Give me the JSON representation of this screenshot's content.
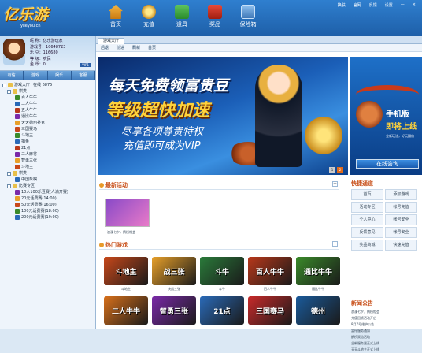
{
  "app": {
    "logo_text": "亿乐游",
    "logo_site": "yileyou.cn"
  },
  "top_links": [
    "换肤",
    "官网",
    "反馈",
    "设置",
    "—",
    "×"
  ],
  "nav": [
    {
      "label": "首页",
      "icon": "home-icon"
    },
    {
      "label": "充值",
      "icon": "coin-bag-icon"
    },
    {
      "label": "道具",
      "icon": "item-icon"
    },
    {
      "label": "奖品",
      "icon": "gift-icon"
    },
    {
      "label": "保险箱",
      "icon": "safe-icon"
    }
  ],
  "profile": {
    "lines": [
      "昵 称：",
      "游戏号：",
      "乐 豆：",
      "等 级：",
      "金 币："
    ],
    "values": [
      "亿乐游玩家",
      "10648723",
      "116680",
      "农民",
      "0"
    ],
    "vip": "VIP1"
  },
  "left_tabs": [
    "有信",
    "游戏",
    "娱乐",
    "客服"
  ],
  "tree": [
    {
      "level": 0,
      "label": "游戏大厅",
      "extra": "在线 6875",
      "toggle": ""
    },
    {
      "level": 1,
      "label": "棋类",
      "toggle": "-"
    },
    {
      "level": 2,
      "label": "百人牛牛"
    },
    {
      "level": 2,
      "label": "二人牛牛"
    },
    {
      "level": 2,
      "label": "五人牛牛"
    },
    {
      "level": 2,
      "label": "通比牛牛"
    },
    {
      "level": 2,
      "label": "天天德州扑克"
    },
    {
      "level": 2,
      "label": "三国赛马"
    },
    {
      "level": 2,
      "label": "斗地主"
    },
    {
      "level": 2,
      "label": "捕鱼"
    },
    {
      "level": 2,
      "label": "21点"
    },
    {
      "level": 2,
      "label": "二人麻将"
    },
    {
      "level": 2,
      "label": "智勇三张"
    },
    {
      "level": 2,
      "label": "斗地主"
    },
    {
      "level": 1,
      "label": "棋类",
      "toggle": "-"
    },
    {
      "level": 2,
      "label": "中国象棋"
    },
    {
      "level": 1,
      "label": "比赛专区",
      "toggle": "-"
    },
    {
      "level": 2,
      "label": "10人100乐豆赛(人满开赛)"
    },
    {
      "level": 2,
      "label": "20元话费赛(14:00)"
    },
    {
      "level": 2,
      "label": "50元话费赛(16:00)"
    },
    {
      "level": 2,
      "label": "100元话费赛(18:00)"
    },
    {
      "level": 2,
      "label": "200元话费赛(19:00)"
    }
  ],
  "main": {
    "page_tab": "游戏大厅",
    "toolbar": [
      "后退",
      "前进",
      "刷新",
      "首页"
    ],
    "banner": {
      "line1": "每天免费领富贵豆",
      "line2": "等级超快加速",
      "line3": "尽享各项尊贵特权",
      "line4": "充值即可成为VIP",
      "pages": [
        "1",
        "2"
      ]
    },
    "side_ad": {
      "title": "手机版",
      "subtitle": "即将上线",
      "sub2": "全新玩法，好玩翻倍",
      "button": "在线咨询"
    },
    "latest_title": "最新活动",
    "latest_caption": "浪漫七夕，鹊桥相会",
    "hot_title": "热门游戏",
    "games": [
      {
        "name": "斗地主",
        "tile": "斗地主",
        "color": "#c8481a"
      },
      {
        "name": "决战三张",
        "tile": "战三张",
        "color": "#e8a02a"
      },
      {
        "name": "斗牛",
        "tile": "斗牛",
        "color": "#2a7a3a"
      },
      {
        "name": "百人牛牛",
        "tile": "百人牛牛",
        "color": "#b8381a"
      },
      {
        "name": "通比牛牛",
        "tile": "通比牛牛",
        "color": "#3a8a2a"
      },
      {
        "name": "二人牛牛",
        "tile": "二人牛牛",
        "color": "#d8701a"
      },
      {
        "name": "智勇三张",
        "tile": "智勇三张",
        "color": "#7a2aa8"
      },
      {
        "name": "21点",
        "tile": "21点",
        "color": "#2a6ab8"
      },
      {
        "name": "三国赛马",
        "tile": "三国赛马",
        "color": "#c82a2a"
      },
      {
        "name": "天天德州",
        "tile": "德州",
        "color": "#1a5a9a"
      }
    ]
  },
  "right": {
    "svc_title": "快捷通道",
    "services": [
      "首页",
      "添加游戏",
      "活动专区",
      "帐号充值",
      "个人中心",
      "帐号安全",
      "反馈意见",
      "帐号安全",
      "奖品商城",
      "快速充值"
    ],
    "news_title": "新闻公告",
    "news": [
      "浪漫七夕，鹊桥相会",
      "充值回馈活动开启",
      "8月7号维护公告",
      "暂停服务通知",
      "鹊桥双倍活动",
      "全新服务器正式上线",
      "天天斗地主正式上线"
    ]
  }
}
